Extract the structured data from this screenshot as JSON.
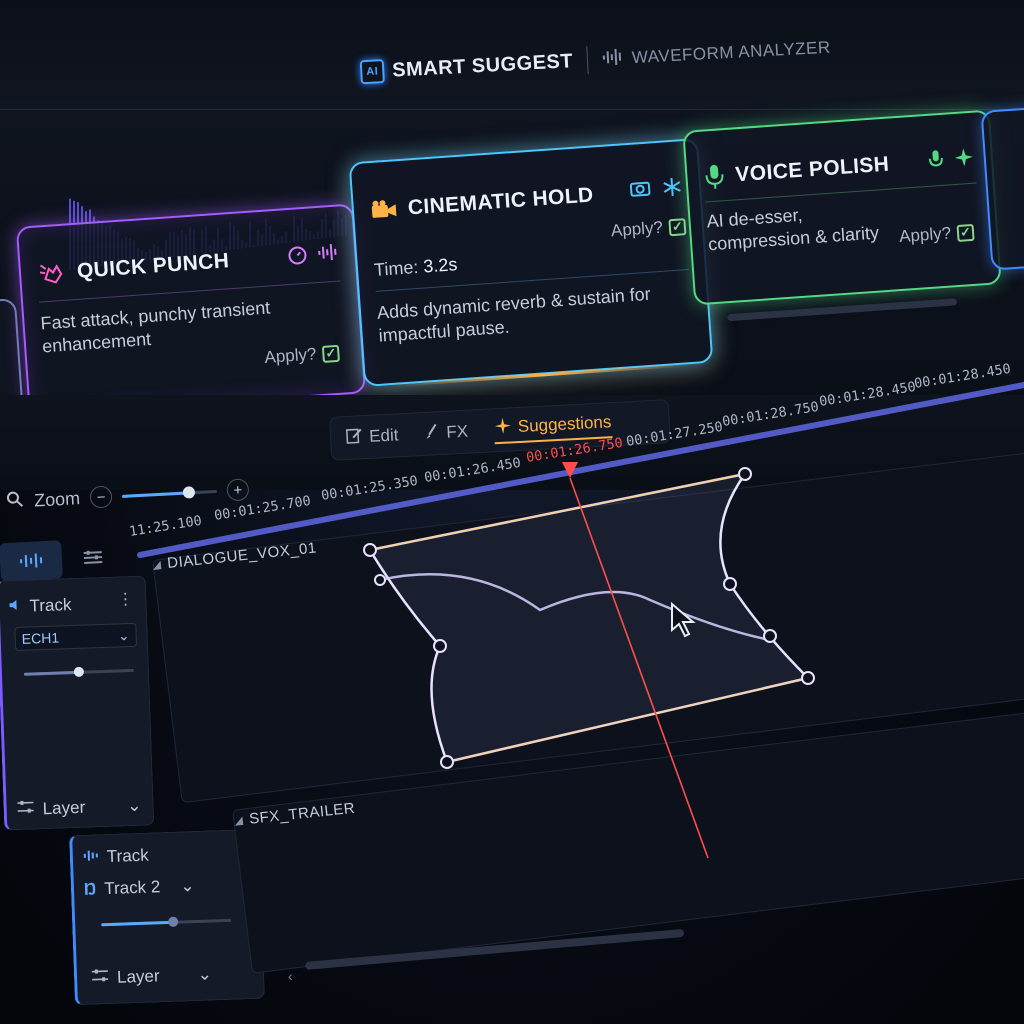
{
  "header": {
    "tabs": [
      {
        "label": "SMART SUGGEST",
        "icon": "ai-chip-icon",
        "active": true
      },
      {
        "label": "WAVEFORM ANALYZER",
        "icon": "waveform-icon",
        "active": false
      }
    ]
  },
  "cards": [
    {
      "title": "QUICK PUNCH",
      "description": "Fast attack, punchy transient enhancement",
      "apply_label": "Apply?",
      "checked": true,
      "accent": "#a45cff",
      "icons": [
        "hand-punch-icon",
        "timer-icon",
        "waveform-icon"
      ]
    },
    {
      "title": "CINEMATIC HOLD",
      "time_label": "Time:",
      "time_value": "3.2s",
      "description": "Adds dynamic reverb & sustain for impactful pause.",
      "apply_label": "Apply?",
      "checked": true,
      "accent": "#4cc6ff",
      "icons": [
        "film-camera-icon",
        "camera-icon",
        "snowflake-icon"
      ]
    },
    {
      "title": "VOICE POLISH",
      "description": "AI de-esser, compression & clarity",
      "apply_label": "Apply?",
      "checked": true,
      "accent": "#53d983",
      "icons": [
        "microphone-icon",
        "microphone-icon",
        "sparkle-icon"
      ]
    }
  ],
  "toolbar": {
    "tabs": [
      {
        "label": "Edit",
        "icon": "edit-icon",
        "active": false
      },
      {
        "label": "FX",
        "icon": "brush-icon",
        "active": false
      },
      {
        "label": "Suggestions",
        "icon": "sparkle-icon",
        "active": true
      }
    ],
    "zoom_label": "Zoom",
    "zoom_minus": "−",
    "zoom_plus": "+",
    "zoom_level": 0.7
  },
  "ruler": {
    "labels": [
      "11:25.100",
      "00:01:25.700",
      "00:01:25.350",
      "00:01:26.450",
      "00:01:26.750",
      "00:01:27.250",
      "00:01:28.750",
      "00:01:28.450",
      "00:01:28.450"
    ],
    "playhead_index": 4
  },
  "tracks": [
    {
      "lane_name": "DIALOGUE_VOX_01",
      "header_label": "Track",
      "select_value": "ECH1",
      "layer_label": "Layer",
      "volume": 0.5
    },
    {
      "lane_name": "SFX_TRAILER",
      "header_label": "Track",
      "select_value": "Track 2",
      "layer_label": "Layer",
      "volume": 0.55
    }
  ],
  "colors": {
    "playhead": "#ff4d4d",
    "wave": "#6a7cff",
    "accent_orange": "#ffb347"
  }
}
